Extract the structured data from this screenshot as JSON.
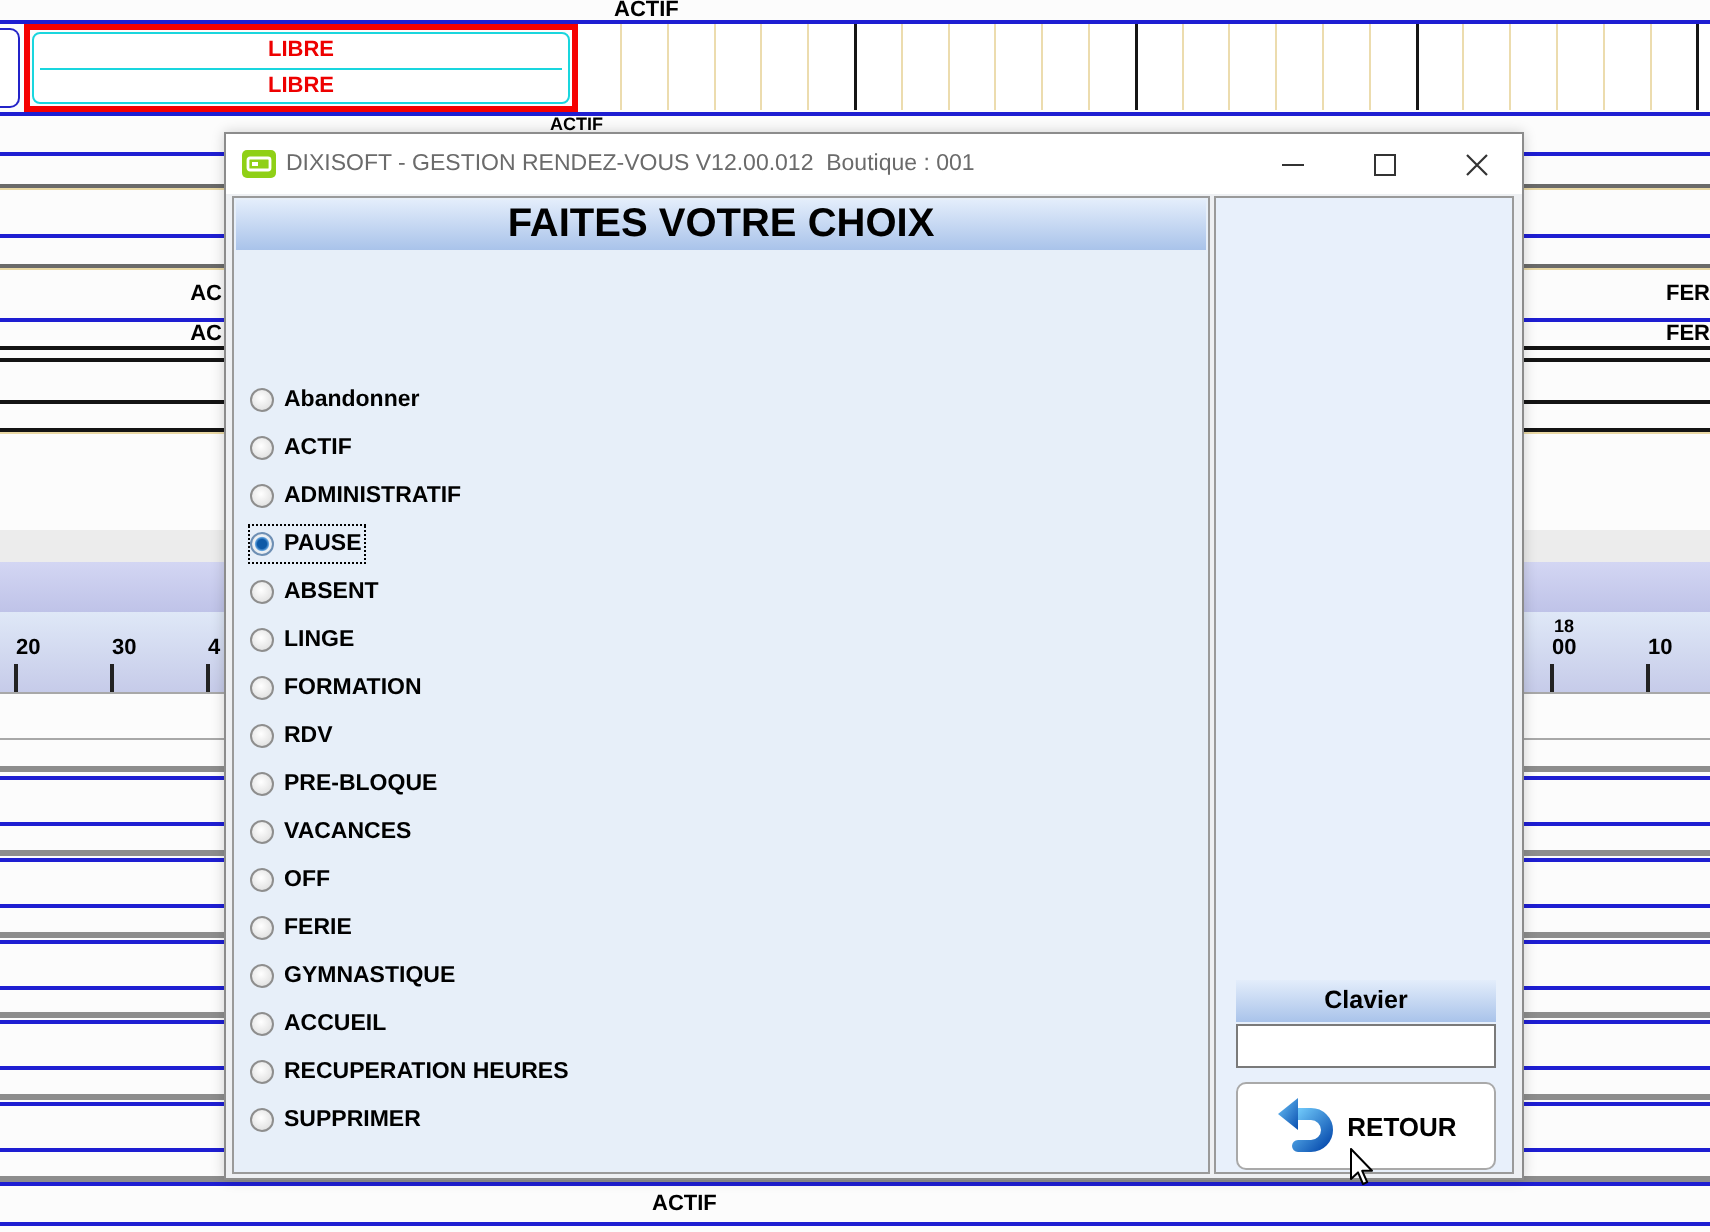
{
  "schedule": {
    "top_label": "ACTIF",
    "slot": {
      "selected": true,
      "lines": [
        "LIBRE",
        "LIBRE"
      ]
    },
    "second_label": "ACTIF",
    "status_rows": [
      {
        "left": "AC",
        "right": "FER"
      },
      {
        "left": "AC",
        "right": "FER"
      }
    ],
    "ruler": {
      "left_ticks": [
        "20",
        "30",
        "4"
      ],
      "hour": "18",
      "right_ticks": [
        "00",
        "10"
      ]
    },
    "bottom_label": "ACTIF"
  },
  "window": {
    "title": "DIXISOFT - GESTION RENDEZ-VOUS V12.00.012  Boutique : 001"
  },
  "choices": {
    "heading": "FAITES VOTRE CHOIX",
    "options": [
      {
        "label": "Abandonner",
        "selected": false,
        "focused": false
      },
      {
        "label": "ACTIF",
        "selected": false,
        "focused": false
      },
      {
        "label": "ADMINISTRATIF",
        "selected": false,
        "focused": false
      },
      {
        "label": "PAUSE",
        "selected": true,
        "focused": true
      },
      {
        "label": "ABSENT",
        "selected": false,
        "focused": false
      },
      {
        "label": "LINGE",
        "selected": false,
        "focused": false
      },
      {
        "label": "FORMATION",
        "selected": false,
        "focused": false
      },
      {
        "label": "RDV",
        "selected": false,
        "focused": false
      },
      {
        "label": "PRE-BLOQUE",
        "selected": false,
        "focused": false
      },
      {
        "label": "VACANCES",
        "selected": false,
        "focused": false
      },
      {
        "label": "OFF",
        "selected": false,
        "focused": false
      },
      {
        "label": "FERIE",
        "selected": false,
        "focused": false
      },
      {
        "label": "GYMNASTIQUE",
        "selected": false,
        "focused": false
      },
      {
        "label": "ACCUEIL",
        "selected": false,
        "focused": false
      },
      {
        "label": "RECUPERATION HEURES",
        "selected": false,
        "focused": false
      },
      {
        "label": "SUPPRIMER",
        "selected": false,
        "focused": false
      }
    ]
  },
  "keyboard": {
    "label": "Clavier"
  },
  "buttons": [
    {
      "label": "RETOUR"
    }
  ]
}
